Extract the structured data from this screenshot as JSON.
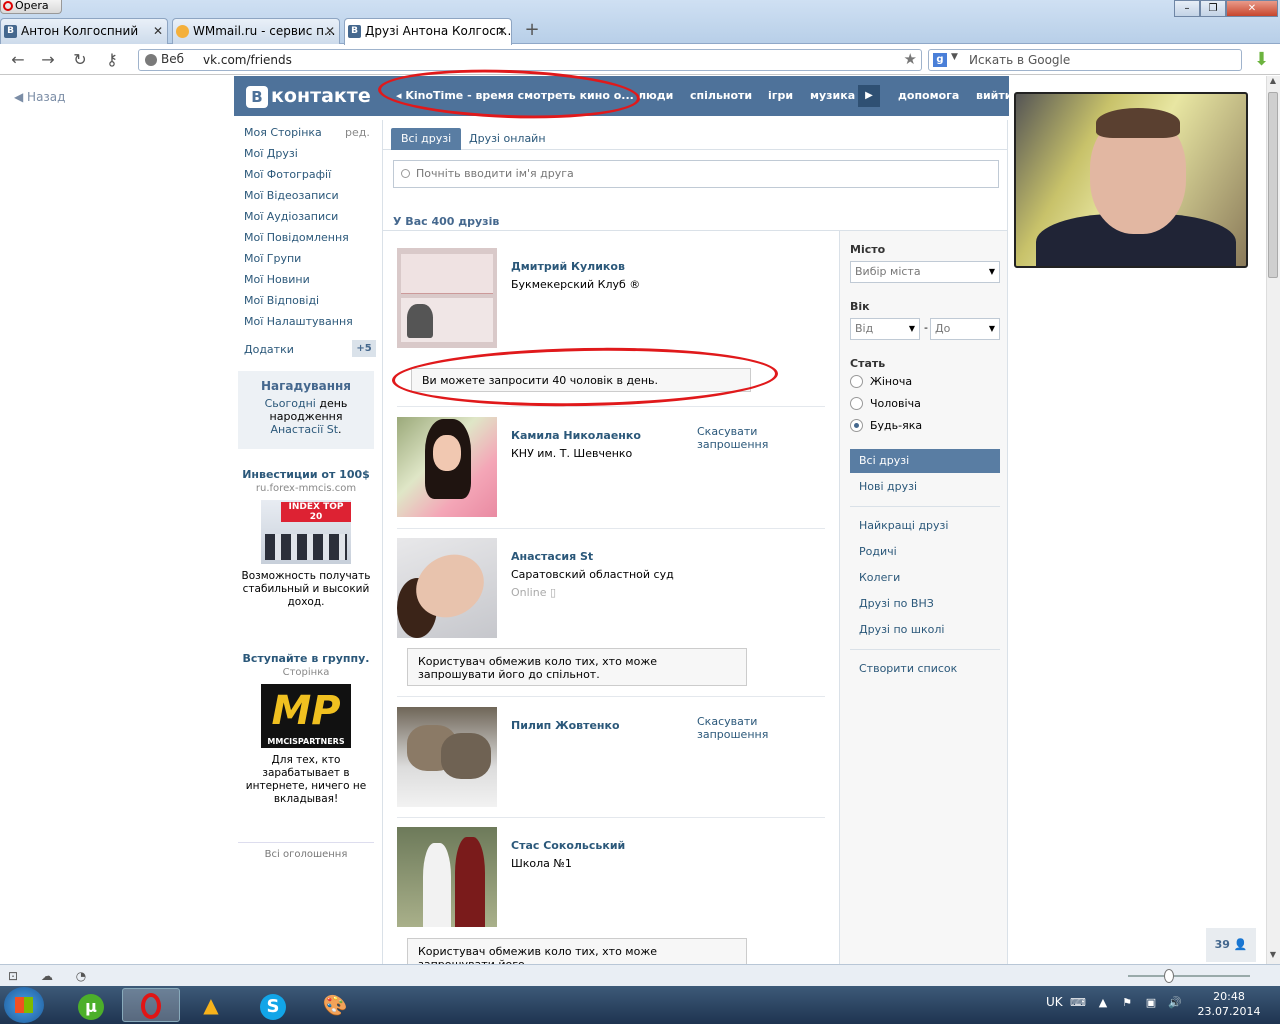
{
  "browser": {
    "menu_label": "Opera",
    "tabs": [
      {
        "title": "Антон Колгоспний",
        "favicon": "В"
      },
      {
        "title": "WMmail.ru - сервис п...",
        "favicon": "W"
      },
      {
        "title": "Друзі Антона Колгосп...",
        "favicon": "В"
      }
    ],
    "url_label": "Веб",
    "url": "vk.com/friends",
    "search_placeholder": "Искать в Google"
  },
  "page": {
    "back_label": "Назад",
    "header": {
      "logo_text": "контакте",
      "logo_letter": "В",
      "promo_text": "KinoTime - время смотреть кино о...",
      "nav": [
        "люди",
        "спільноти",
        "ігри",
        "музика",
        "допомога",
        "вийти"
      ]
    },
    "left_menu": {
      "items": [
        "Моя Сторінка",
        "Мої Друзі",
        "Мої Фотографії",
        "Мої Відеозаписи",
        "Мої Аудіозаписи",
        "Мої Повідомлення",
        "Мої Групи",
        "Мої Новини",
        "Мої Відповіді",
        "Мої Налаштування"
      ],
      "edit_label": "ред.",
      "apps_label": "Додатки",
      "apps_badge": "+5"
    },
    "reminder": {
      "title": "Нагадування",
      "today": "Сьогодні",
      "text_mid": " день народження ",
      "person": "Анастасії St",
      "end": "."
    },
    "ads": [
      {
        "title": "Инвестиции от 100$",
        "sub": "ru.forex-mmcis.com",
        "img_label": "INDEX TOP 20",
        "body": "Возможность получать стабильный и высокий доход."
      },
      {
        "title": "Вступайте в группу.",
        "sub": "Сторінка",
        "img_label": "MP",
        "img_sub": "MMCISPARTNERS",
        "body": "Для тех, кто зарабатывает в интернете, ничего не вкладывая!"
      }
    ],
    "ads_all": "Всі оголошення",
    "friends": {
      "tabs": [
        "Всі друзі",
        "Друзі онлайн"
      ],
      "search_placeholder": "Почніть вводити ім'я друга",
      "count_label": "У Вас 400 друзів",
      "list": [
        {
          "name": "Дмитрий Куликов",
          "sub": "Букмекерский Клуб ®",
          "cancel": "",
          "online": ""
        },
        {
          "name": "Камила Николаенко",
          "sub": "КНУ им. Т. Шевченко",
          "cancel": "Скасувати запрошення",
          "online": ""
        },
        {
          "name": "Анастасия St",
          "sub": "Саратовский областной суд",
          "cancel": "",
          "online": "Online"
        },
        {
          "name": "Пилип Жовтенко",
          "sub": "",
          "cancel": "Скасувати запрошення",
          "online": ""
        },
        {
          "name": "Стас Сокольський",
          "sub": "Школа №1",
          "cancel": "",
          "online": ""
        }
      ],
      "notice_limit": "Ви можете запросити 40 чоловік в день.",
      "notice_restricted": "Користувач обмежив коло тих, хто може запрошувати його до спільнот.",
      "notice_restricted_partial": "Користувач обмежив коло тих, хто може запрошувати його"
    },
    "filter": {
      "city_label": "Місто",
      "city_placeholder": "Вибір міста",
      "age_label": "Вік",
      "age_from": "Від",
      "age_dash": "-",
      "age_to": "До",
      "sex_label": "Стать",
      "sex_options": [
        "Жіноча",
        "Чоловіча",
        "Будь-яка"
      ],
      "sex_selected": "Будь-яка",
      "lists": [
        "Всі друзі",
        "Нові друзі"
      ],
      "lists2": [
        "Найкращі друзі",
        "Родичі",
        "Колеги",
        "Друзі по ВНЗ",
        "Друзі по школі"
      ],
      "create_list": "Створити список"
    },
    "people_count": "39"
  },
  "taskbar": {
    "lang": "UK",
    "time": "20:48",
    "date": "23.07.2014"
  },
  "colors": {
    "vk_blue": "#4e729a",
    "link": "#2b587a",
    "annotation_red": "#e0191b"
  }
}
